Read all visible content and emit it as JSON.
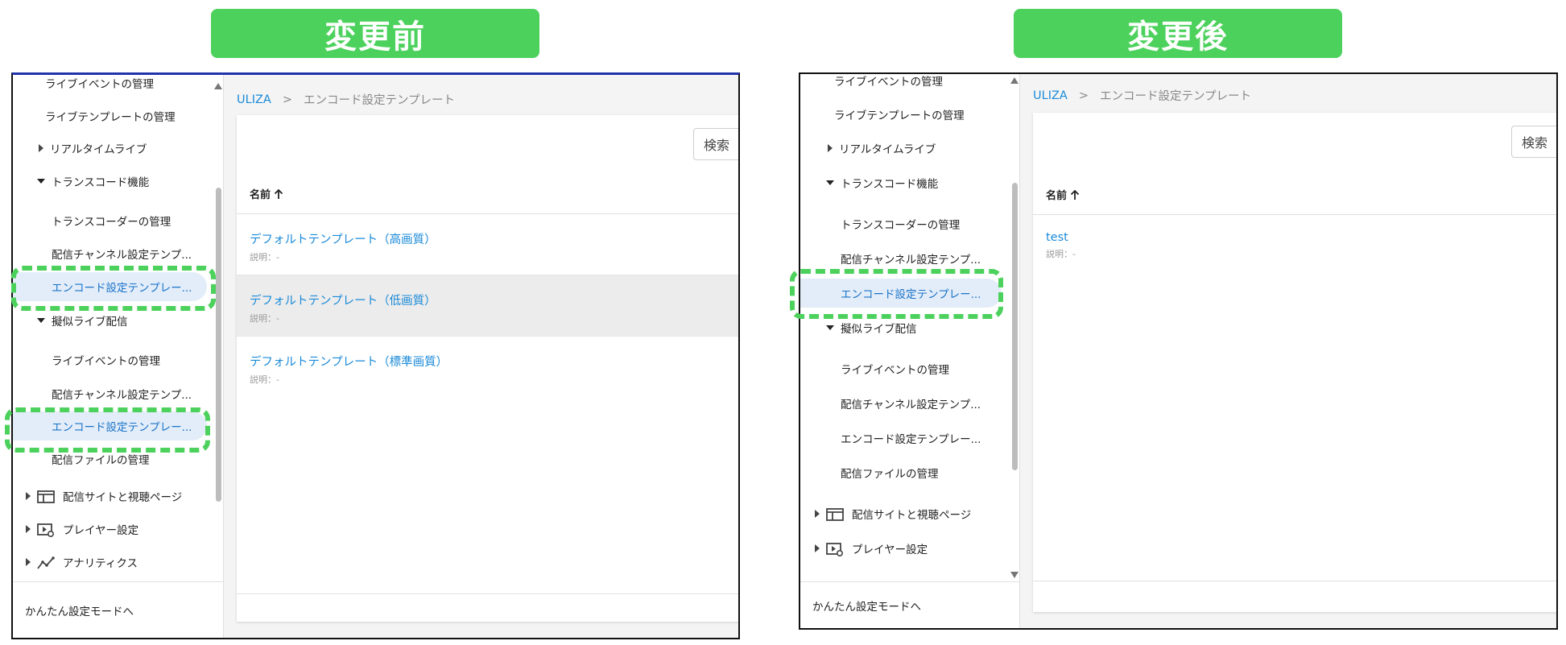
{
  "before": {
    "banner": "変更前",
    "sidebar": {
      "items": [
        {
          "label": "ライブイベントの管理"
        },
        {
          "label": "ライブテンプレートの管理"
        },
        {
          "label": "リアルタイムライブ"
        },
        {
          "label": "トランスコード機能"
        },
        {
          "label": "トランスコーダーの管理"
        },
        {
          "label": "配信チャンネル設定テンプ..."
        },
        {
          "label": "エンコード設定テンプレー..."
        },
        {
          "label": "擬似ライブ配信"
        },
        {
          "label": "ライブイベントの管理"
        },
        {
          "label": "配信チャンネル設定テンプ..."
        },
        {
          "label": "エンコード設定テンプレー..."
        },
        {
          "label": "配信ファイルの管理"
        },
        {
          "label": "配信サイトと視聴ページ"
        },
        {
          "label": "プレイヤー設定"
        },
        {
          "label": "アナリティクス"
        }
      ],
      "footer": "かんたん設定モードへ"
    },
    "breadcrumb": {
      "root": "ULIZA",
      "sep": ">",
      "current": "エンコード設定テンプレート"
    },
    "search_label": "検索",
    "column_header": "名前",
    "rows": [
      {
        "title": "デフォルトテンプレート（高画質）",
        "desc": "説明：-"
      },
      {
        "title": "デフォルトテンプレート（低画質）",
        "desc": "説明：-"
      },
      {
        "title": "デフォルトテンプレート（標準画質）",
        "desc": "説明：-"
      }
    ]
  },
  "after": {
    "banner": "変更後",
    "sidebar": {
      "items": [
        {
          "label": "ライブイベントの管理"
        },
        {
          "label": "ライブテンプレートの管理"
        },
        {
          "label": "リアルタイムライブ"
        },
        {
          "label": "トランスコード機能"
        },
        {
          "label": "トランスコーダーの管理"
        },
        {
          "label": "配信チャンネル設定テンプ..."
        },
        {
          "label": "エンコード設定テンプレー..."
        },
        {
          "label": "擬似ライブ配信"
        },
        {
          "label": "ライブイベントの管理"
        },
        {
          "label": "配信チャンネル設定テンプ..."
        },
        {
          "label": "エンコード設定テンプレー..."
        },
        {
          "label": "配信ファイルの管理"
        },
        {
          "label": "配信サイトと視聴ページ"
        },
        {
          "label": "プレイヤー設定"
        }
      ],
      "footer": "かんたん設定モードへ"
    },
    "breadcrumb": {
      "root": "ULIZA",
      "sep": ">",
      "current": "エンコード設定テンプレート"
    },
    "search_label": "検索",
    "column_header": "名前",
    "rows": [
      {
        "title": "test",
        "desc": "説明：-"
      }
    ]
  },
  "colors": {
    "highlight_green": "#4cd15c",
    "link_blue": "#1a8ad8",
    "active_bg": "#e3edf9"
  },
  "icons": {
    "sort": "arrow-up-icon",
    "expand": "triangle-right-icon",
    "collapse": "triangle-down-icon",
    "site": "layout-icon",
    "player": "video-settings-icon",
    "analytics": "chart-line-icon"
  }
}
